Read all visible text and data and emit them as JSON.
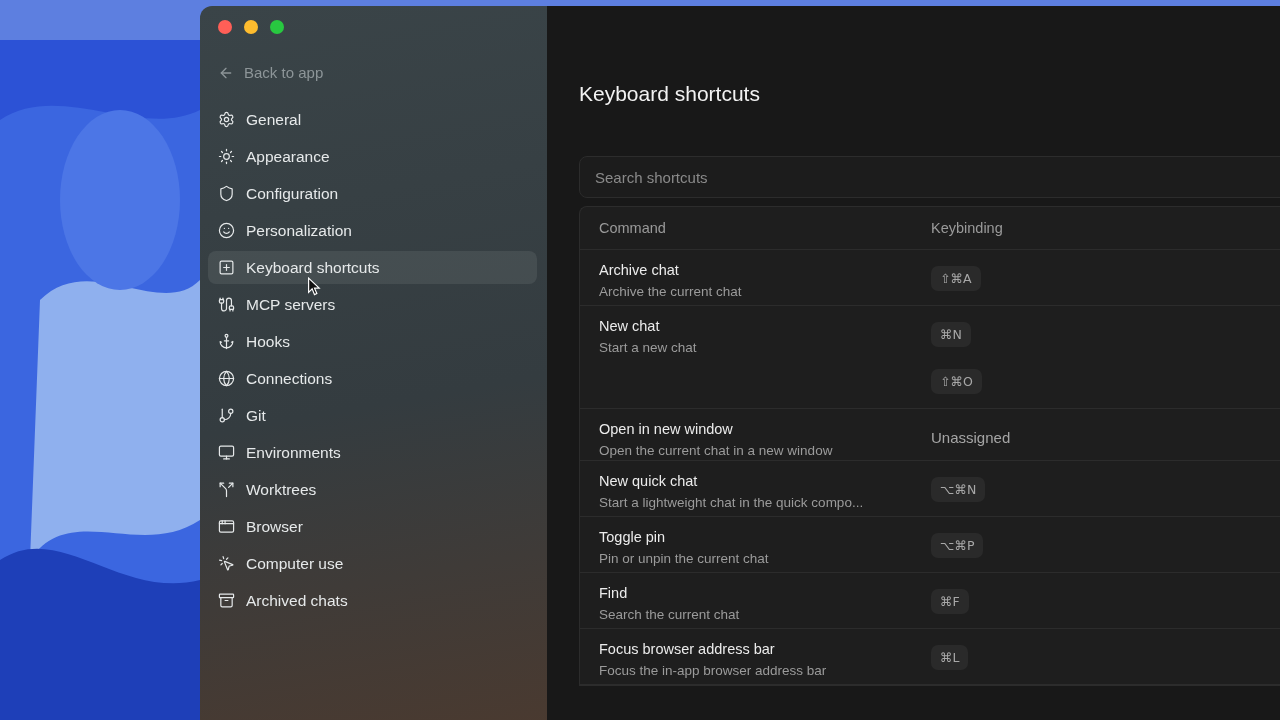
{
  "sidebar": {
    "back_link": "Back to app",
    "items": [
      {
        "label": "General",
        "selected": false
      },
      {
        "label": "Appearance",
        "selected": false
      },
      {
        "label": "Configuration",
        "selected": false
      },
      {
        "label": "Personalization",
        "selected": false
      },
      {
        "label": "Keyboard shortcuts",
        "selected": true
      },
      {
        "label": "MCP servers",
        "selected": false
      },
      {
        "label": "Hooks",
        "selected": false
      },
      {
        "label": "Connections",
        "selected": false
      },
      {
        "label": "Git",
        "selected": false
      },
      {
        "label": "Environments",
        "selected": false
      },
      {
        "label": "Worktrees",
        "selected": false
      },
      {
        "label": "Browser",
        "selected": false
      },
      {
        "label": "Computer use",
        "selected": false
      },
      {
        "label": "Archived chats",
        "selected": false
      }
    ]
  },
  "main": {
    "title": "Keyboard shortcuts",
    "search": {
      "placeholder": "Search shortcuts"
    },
    "table": {
      "columns": [
        "Command",
        "Keybinding"
      ],
      "rows": [
        {
          "command": "Archive chat",
          "description": "Archive the current chat",
          "bindings": [
            {
              "kind": "key",
              "label": "⇧⌘A"
            }
          ]
        },
        {
          "command": "New chat",
          "description": "Start a new chat",
          "bindings": [
            {
              "kind": "key",
              "label": "⌘N"
            },
            {
              "kind": "key",
              "label": "⇧⌘O"
            }
          ]
        },
        {
          "command": "Open in new window",
          "description": "Open the current chat in a new window",
          "bindings": [
            {
              "kind": "text",
              "label": "Unassigned"
            }
          ]
        },
        {
          "command": "New quick chat",
          "description": "Start a lightweight chat in the quick compo...",
          "bindings": [
            {
              "kind": "key",
              "label": "⌥⌘N"
            }
          ]
        },
        {
          "command": "Toggle pin",
          "description": "Pin or unpin the current chat",
          "bindings": [
            {
              "kind": "key",
              "label": "⌥⌘P"
            }
          ]
        },
        {
          "command": "Find",
          "description": "Search the current chat",
          "bindings": [
            {
              "kind": "key",
              "label": "⌘F"
            }
          ]
        },
        {
          "command": "Focus browser address bar",
          "description": "Focus the in-app browser address bar",
          "bindings": [
            {
              "kind": "key",
              "label": "⌘L"
            }
          ]
        }
      ]
    }
  }
}
